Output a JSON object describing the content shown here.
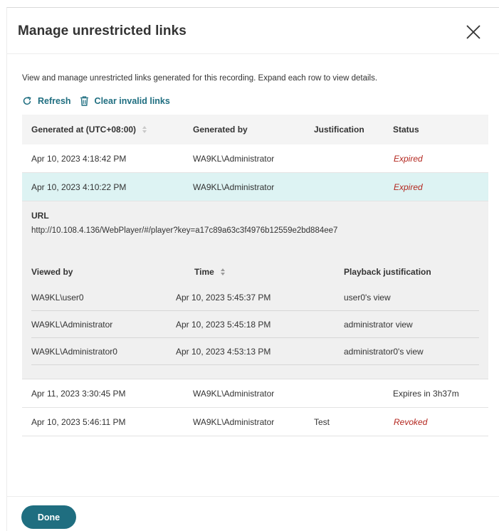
{
  "dialog": {
    "title": "Manage unrestricted links",
    "description": "View and manage unrestricted links generated for this recording. Expand each row to view details.",
    "done_label": "Done"
  },
  "actions": {
    "refresh_label": "Refresh",
    "clear_label": "Clear invalid links"
  },
  "table": {
    "headers": {
      "generated_at": "Generated at (UTC+08:00)",
      "generated_by": "Generated by",
      "justification": "Justification",
      "status": "Status"
    },
    "rows": [
      {
        "generated_at": "Apr 10, 2023 4:18:42 PM",
        "generated_by": "WA9KL\\Administrator",
        "justification": "",
        "status": "Expired"
      },
      {
        "generated_at": "Apr 10, 2023 4:10:22 PM",
        "generated_by": "WA9KL\\Administrator",
        "justification": "",
        "status": "Expired"
      },
      {
        "generated_at": "Apr 11, 2023 3:30:45 PM",
        "generated_by": "WA9KL\\Administrator",
        "justification": "",
        "status": "Expires in 3h37m"
      },
      {
        "generated_at": "Apr 10, 2023 5:46:11 PM",
        "generated_by": "WA9KL\\Administrator",
        "justification": "Test",
        "status": "Revoked"
      }
    ]
  },
  "expanded": {
    "url_label": "URL",
    "url": "http://10.108.4.136/WebPlayer/#/player?key=a17c89a63c3f4976b12559e2bd884ee7",
    "headers": {
      "viewed_by": "Viewed by",
      "time": "Time",
      "justification": "Playback justification"
    },
    "rows": [
      {
        "viewed_by": "WA9KL\\user0",
        "time": "Apr 10, 2023 5:45:37 PM",
        "justification": "user0's view"
      },
      {
        "viewed_by": "WA9KL\\Administrator",
        "time": "Apr 10, 2023 5:45:18 PM",
        "justification": "administrator view"
      },
      {
        "viewed_by": "WA9KL\\Administrator0",
        "time": "Apr 10, 2023 4:53:13 PM",
        "justification": "administrator0's view"
      }
    ]
  },
  "colors": {
    "accent": "#1f6e80",
    "selected_row": "#ddf3f3",
    "expired": "#b3261e"
  },
  "icons": [
    "close-icon",
    "refresh-icon",
    "trash-icon",
    "sort-icon"
  ]
}
